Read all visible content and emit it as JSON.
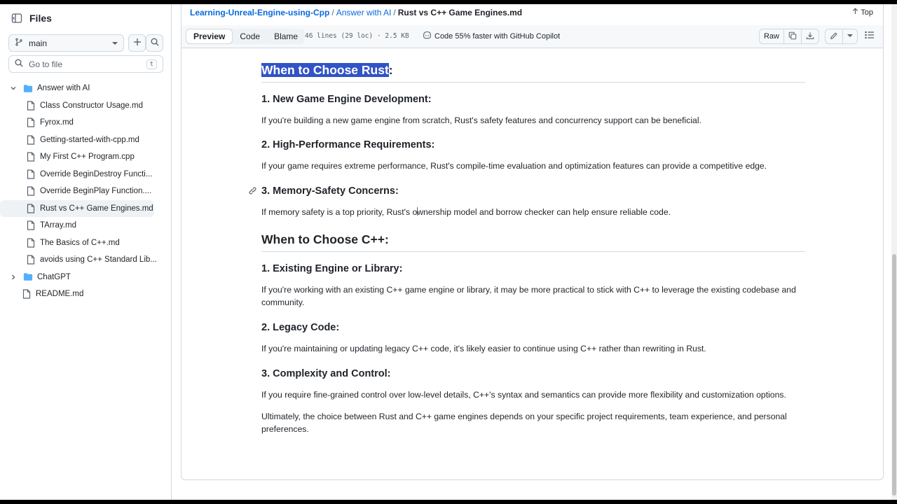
{
  "sidebar": {
    "title": "Files",
    "branch": "main",
    "goto_placeholder": "Go to file",
    "goto_shortcut": "t",
    "tree": [
      {
        "label": "Answer with AI",
        "type": "folder",
        "expanded": true,
        "depth": 0
      },
      {
        "label": "Class Constructor Usage.md",
        "type": "file",
        "depth": 1
      },
      {
        "label": "Fyrox.md",
        "type": "file",
        "depth": 1
      },
      {
        "label": "Getting-started-with-cpp.md",
        "type": "file",
        "depth": 1
      },
      {
        "label": "My First C++ Program.cpp",
        "type": "file",
        "depth": 1
      },
      {
        "label": "Override BeginDestroy Functi...",
        "type": "file",
        "depth": 1
      },
      {
        "label": "Override BeginPlay Function....",
        "type": "file",
        "depth": 1
      },
      {
        "label": "Rust vs C++ Game Engines.md",
        "type": "file",
        "depth": 1,
        "active": true
      },
      {
        "label": "TArray.md",
        "type": "file",
        "depth": 1
      },
      {
        "label": "The Basics of C++.md",
        "type": "file",
        "depth": 1
      },
      {
        "label": "avoids using C++ Standard Lib...",
        "type": "file",
        "depth": 1
      },
      {
        "label": "ChatGPT",
        "type": "folder",
        "expanded": false,
        "depth": 0
      },
      {
        "label": "README.md",
        "type": "file",
        "depth": 0
      }
    ]
  },
  "header": {
    "breadcrumb": [
      "Learning-Unreal-Engine-using-Cpp",
      "Answer with AI",
      "Rust vs C++ Game Engines.md"
    ],
    "top_label": "Top"
  },
  "toolbar": {
    "tabs": [
      "Preview",
      "Code",
      "Blame"
    ],
    "active_tab": "Preview",
    "meta": "46 lines (29 loc) · 2.5 KB",
    "copilot": "Code 55% faster with GitHub Copilot",
    "raw_label": "Raw"
  },
  "content": {
    "rust_heading_highlight": "When to Choose Rust",
    "rust_heading_suffix": ":",
    "rust": [
      {
        "h": "1. New Game Engine Development:",
        "p": "If you're building a new game engine from scratch, Rust's safety features and concurrency support can be beneficial."
      },
      {
        "h": "2. High-Performance Requirements:",
        "p": "If your game requires extreme performance, Rust's compile-time evaluation and optimization features can provide a competitive edge."
      },
      {
        "h": "3. Memory-Safety Concerns:",
        "p": "If memory safety is a top priority, Rust's ownership model and borrow checker can help ensure reliable code."
      }
    ],
    "cpp_heading": "When to Choose C++:",
    "cpp": [
      {
        "h": "1. Existing Engine or Library:",
        "p": "If you're working with an existing C++ game engine or library, it may be more practical to stick with C++ to leverage the existing codebase and community."
      },
      {
        "h": "2. Legacy Code:",
        "p": "If you're maintaining or updating legacy C++ code, it's likely easier to continue using C++ rather than rewriting in Rust."
      },
      {
        "h": "3. Complexity and Control:",
        "p": "If you require fine-grained control over low-level details, C++'s syntax and semantics can provide more flexibility and customization options."
      }
    ],
    "conclusion": "Ultimately, the choice between Rust and C++ game engines depends on your specific project requirements, team experience, and personal preferences."
  }
}
